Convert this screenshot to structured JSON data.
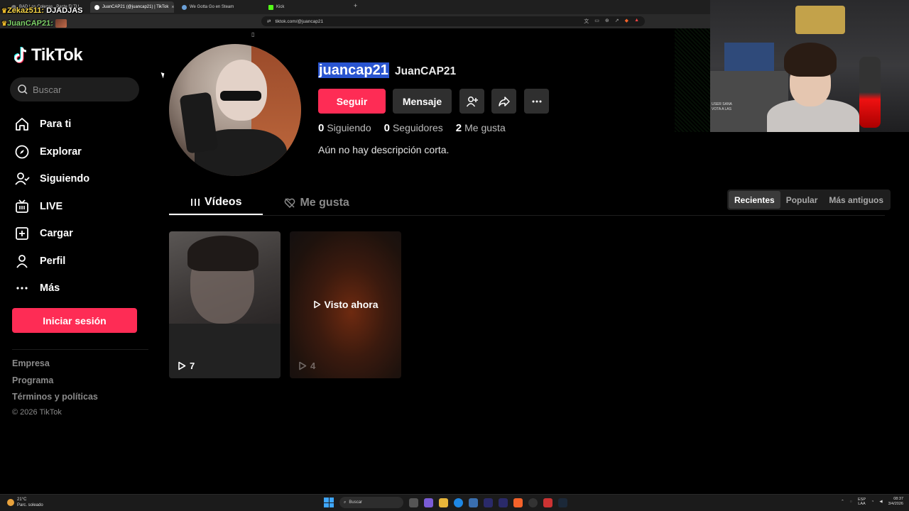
{
  "browser": {
    "tabs": [
      {
        "label": "BAD Los Colegas...Paste El TU"
      },
      {
        "label": "JuanCAP21 (@juancap21) | TikTok"
      },
      {
        "label": "We Gotta Go en Steam"
      },
      {
        "label": "Kick"
      }
    ],
    "new_tab": "+",
    "close": "×",
    "url": "tiktok.com/@juancap21"
  },
  "chat": {
    "line1_user": "Zekaz511:",
    "line1_text": "DJADJAS",
    "line2_user": "JuanCAP21:"
  },
  "sidebar": {
    "logo_text": "TikTok",
    "search_placeholder": "Buscar",
    "nav": [
      {
        "label": "Para ti",
        "icon": "home-icon"
      },
      {
        "label": "Explorar",
        "icon": "compass-icon"
      },
      {
        "label": "Siguiendo",
        "icon": "following-icon"
      },
      {
        "label": "LIVE",
        "icon": "live-icon"
      },
      {
        "label": "Cargar",
        "icon": "upload-icon"
      },
      {
        "label": "Perfil",
        "icon": "profile-icon"
      },
      {
        "label": "Más",
        "icon": "more-icon"
      }
    ],
    "login_label": "Iniciar sesión",
    "footer": [
      "Empresa",
      "Programa",
      "Términos y políticas"
    ],
    "copyright": "© 2026 TikTok"
  },
  "profile": {
    "username": "juancap21",
    "nickname": "JuanCAP21",
    "follow_label": "Seguir",
    "message_label": "Mensaje",
    "stats": [
      {
        "value": "0",
        "label": "Siguiendo"
      },
      {
        "value": "0",
        "label": "Seguidores"
      },
      {
        "value": "2",
        "label": "Me gusta"
      }
    ],
    "bio": "Aún no hay descripción corta."
  },
  "tabs": {
    "videos_label": "Vídeos",
    "likes_label": "Me gusta"
  },
  "sort": {
    "options": [
      "Recientes",
      "Popular",
      "Más antiguos"
    ],
    "selected": "Recientes"
  },
  "videos": [
    {
      "views": "7",
      "watched": false
    },
    {
      "views": "4",
      "watched": true,
      "watched_label": "Visto ahora"
    }
  ],
  "webcam": {
    "overlay_line1": "USER SANA",
    "overlay_line2": "VOTA A LAS"
  },
  "taskbar": {
    "temp": "21°C",
    "weather": "Parc. soleado",
    "search": "Buscar",
    "lang1": "ESP",
    "lang2": "LAA",
    "time": "08:37",
    "date": "3/4/2026"
  },
  "colors": {
    "accent": "#fe2c55",
    "background": "#000000",
    "selection": "#2a55d0"
  }
}
